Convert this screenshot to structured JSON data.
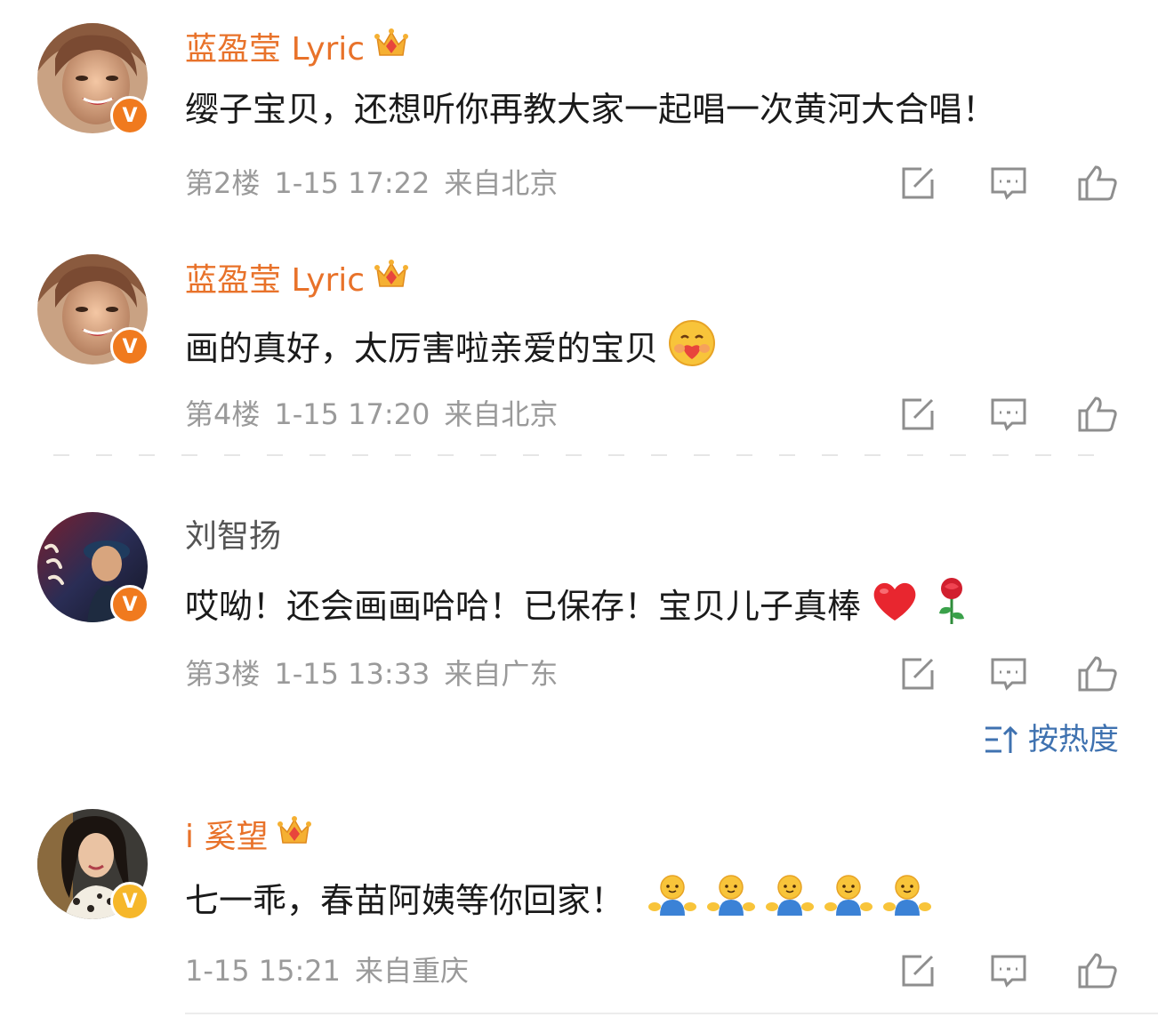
{
  "colors": {
    "vip_name": "#e8722a",
    "normal_name": "#555555",
    "meta_text": "#9a9a9a",
    "sort_link": "#3f72b0",
    "verified_orange": "#f07a1e",
    "verified_yellow": "#f6b72a",
    "icon_stroke": "#8e8e8e"
  },
  "comments": [
    {
      "username": "蓝盈莹 Lyric",
      "is_vip": true,
      "verified_type": "orange",
      "avatar": "woman-smiling-avatar",
      "text": "缨子宝贝，还想听你再教大家一起唱一次黄河大合唱！",
      "emojis": [],
      "floor": "第2楼",
      "time": "1-15 17:22",
      "location": "来自北京"
    },
    {
      "username": "蓝盈莹 Lyric",
      "is_vip": true,
      "verified_type": "orange",
      "avatar": "woman-smiling-avatar",
      "text": "画的真好，太厉害啦亲爱的宝贝",
      "emojis": [
        "hugging-heart-emoji"
      ],
      "floor": "第4楼",
      "time": "1-15 17:20",
      "location": "来自北京"
    },
    {
      "username": "刘智扬",
      "is_vip": false,
      "verified_type": "orange",
      "avatar": "man-poster-avatar",
      "text": "哎呦！还会画画哈哈！已保存！宝贝儿子真棒",
      "emojis": [
        "red-heart-emoji",
        "rose-emoji"
      ],
      "floor": "第3楼",
      "time": "1-15 13:33",
      "location": "来自广东"
    },
    {
      "username": "i 奚望",
      "is_vip": true,
      "verified_type": "yellow",
      "avatar": "woman-portrait-avatar",
      "text": "七一乖，春苗阿姨等你回家！",
      "emojis": [
        "hug-person-emoji",
        "hug-person-emoji",
        "hug-person-emoji",
        "hug-person-emoji",
        "hug-person-emoji"
      ],
      "floor": "",
      "time": "1-15 15:21",
      "location": "来自重庆"
    }
  ],
  "actions": {
    "share_icon": "share-icon",
    "comment_icon": "comment-icon",
    "like_icon": "like-icon"
  },
  "sort": {
    "label": "按热度",
    "icon": "sort-icon"
  },
  "verified_mark": "V"
}
